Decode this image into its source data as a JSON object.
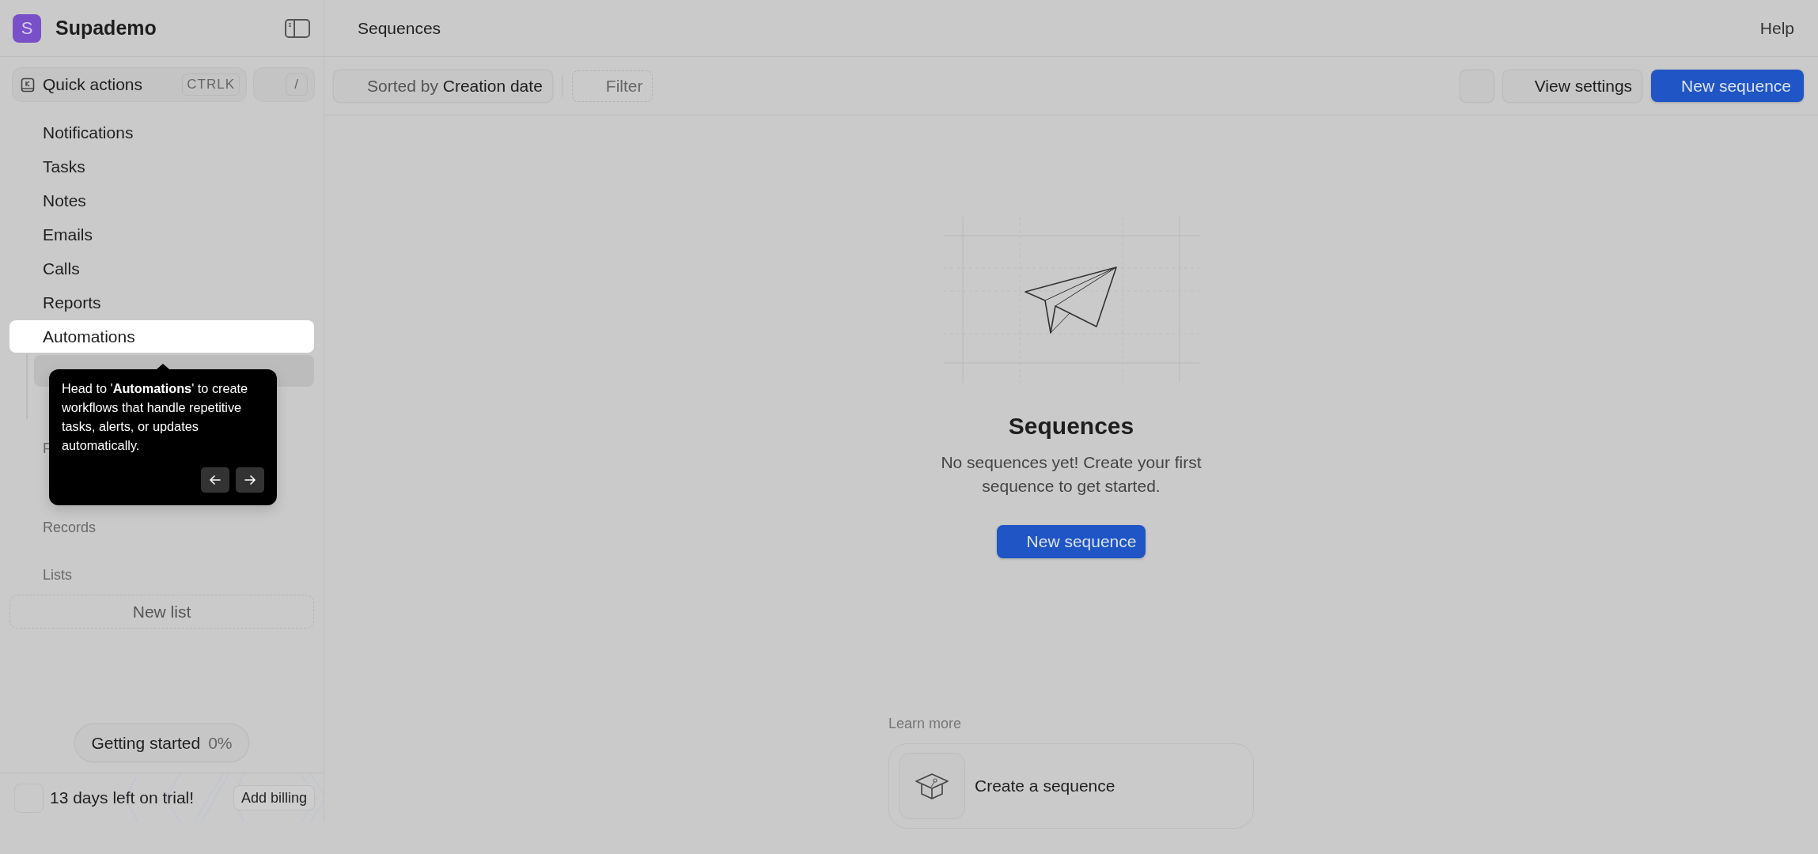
{
  "sidebar": {
    "workspace": {
      "initial": "S",
      "name": "Supademo"
    },
    "quick_actions": {
      "label": "Quick actions",
      "shortcut": "CTRLK",
      "slash": "/"
    },
    "nav": [
      {
        "label": "Notifications",
        "selected": false
      },
      {
        "label": "Tasks",
        "selected": false
      },
      {
        "label": "Notes",
        "selected": false
      },
      {
        "label": "Emails",
        "selected": false
      },
      {
        "label": "Calls",
        "selected": false
      },
      {
        "label": "Reports",
        "selected": false
      },
      {
        "label": "Automations",
        "selected": true,
        "children": [
          {
            "selected": true
          }
        ]
      }
    ],
    "sections": [
      {
        "label": "F"
      },
      {
        "label": "Records"
      },
      {
        "label": "Lists"
      }
    ],
    "new_list": "New list",
    "progress": {
      "label": "Getting started",
      "value": "0%"
    },
    "trial": {
      "text": "13 days left on trial!",
      "button": "Add billing"
    }
  },
  "header": {
    "title": "Sequences",
    "help": "Help"
  },
  "toolbar": {
    "sort": {
      "prefix": "Sorted by",
      "value": "Creation date"
    },
    "filter": "Filter",
    "view_settings": "View settings",
    "new_button": "New sequence"
  },
  "empty_state": {
    "title": "Sequences",
    "description": "No sequences yet! Create your first sequence to get started.",
    "button": "New sequence"
  },
  "learn_more": {
    "heading": "Learn more",
    "items": [
      {
        "title": "Create a sequence"
      }
    ]
  },
  "tooltip": {
    "text": "Head to '**Automations**' to create workflows that handle repetitive tasks, alerts, or updates automatically."
  }
}
